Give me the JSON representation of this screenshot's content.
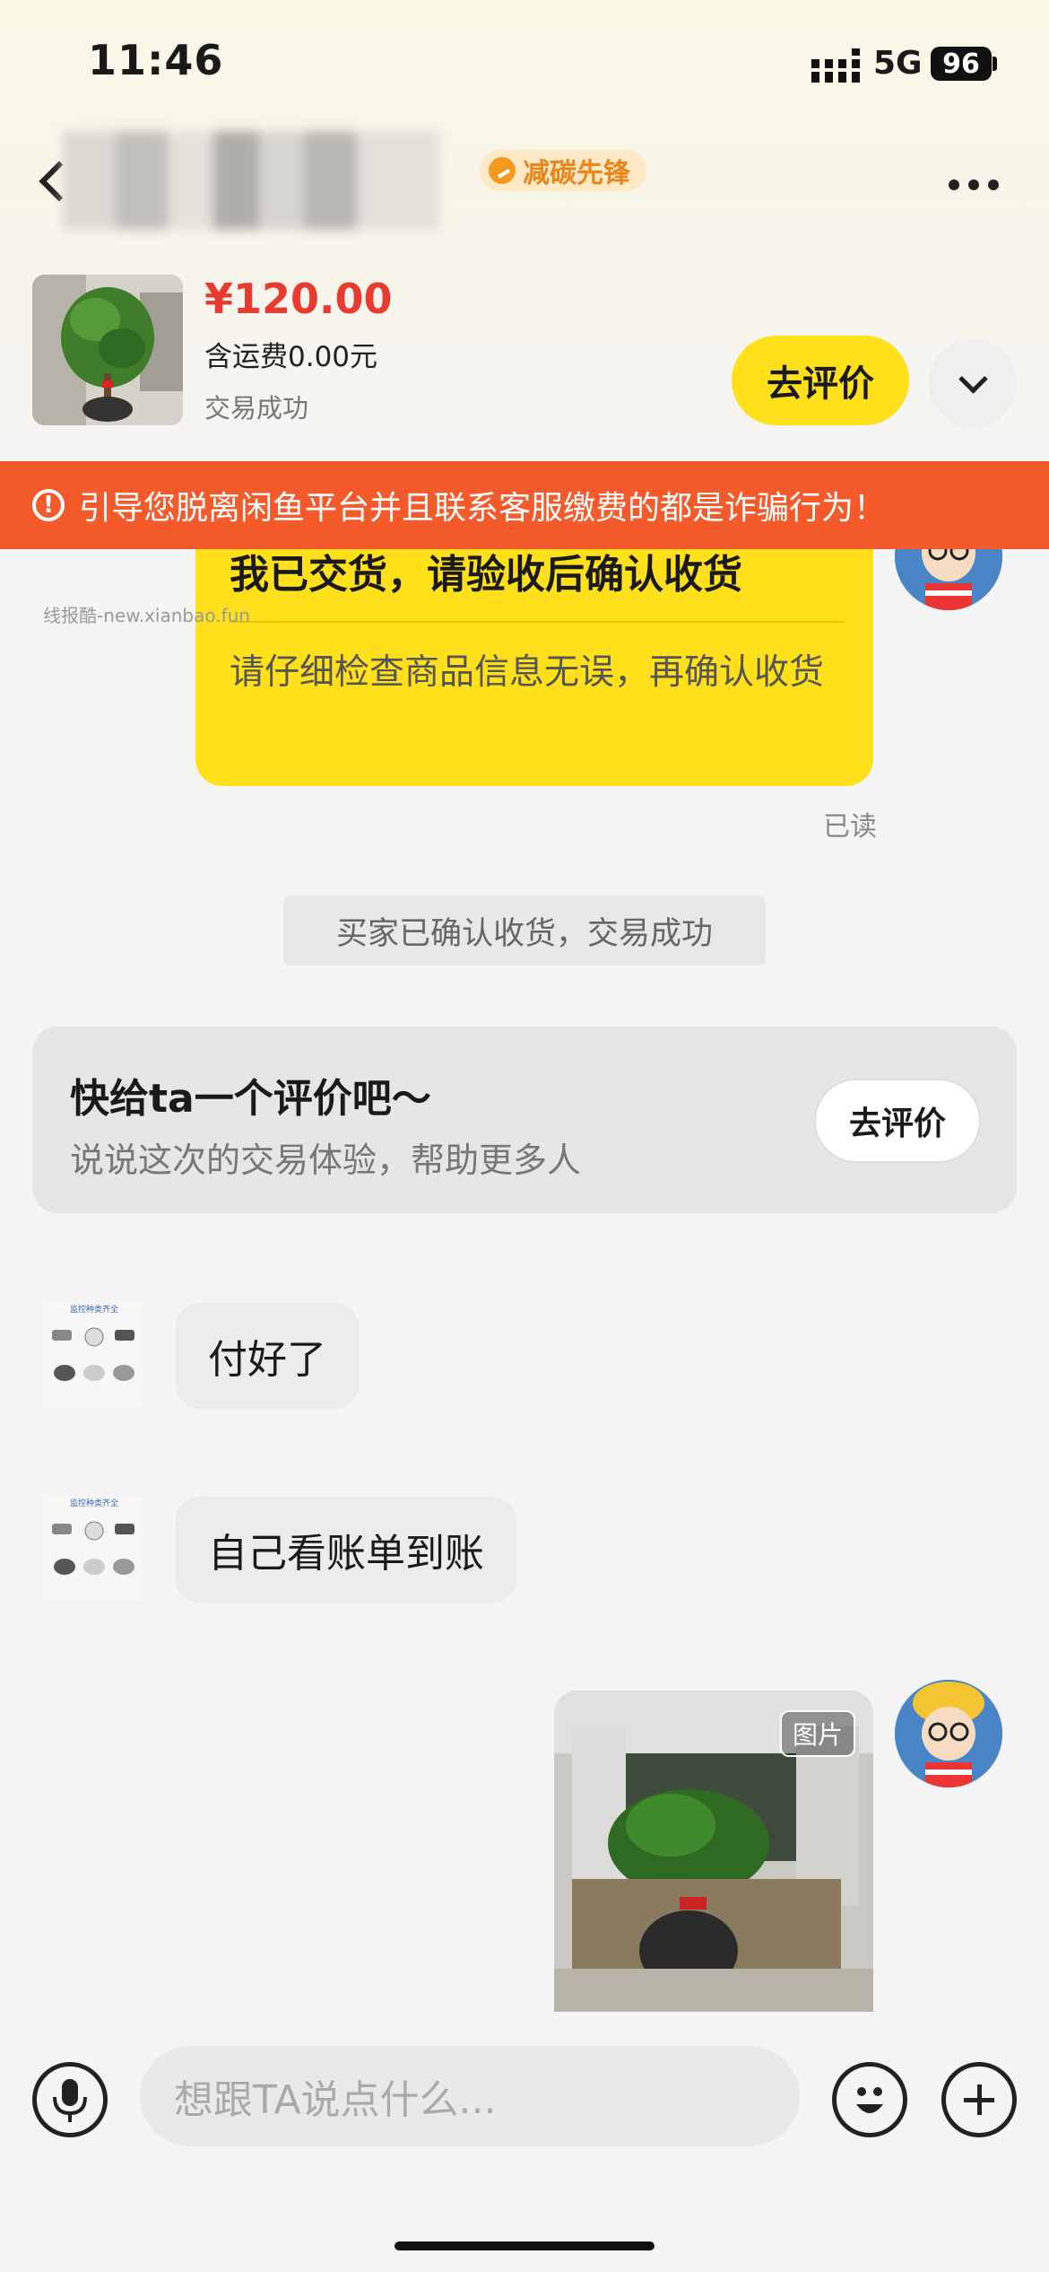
{
  "status_bar": {
    "time": "11:46",
    "network": "5G",
    "battery": "96"
  },
  "nav": {
    "badge": "减碳先锋"
  },
  "product": {
    "price": "¥120.00",
    "shipping": "含运费0.00元",
    "status": "交易成功",
    "review_button": "去评价"
  },
  "warning": {
    "text": "引导您脱离闲鱼平台并且联系客服缴费的都是诈骗行为！",
    "icon": "!"
  },
  "messages": {
    "delivery_card": {
      "title": "我已交货，请验收后确认收货",
      "description": "请仔细检查商品信息无误，再确认收货"
    },
    "read_status": "已读",
    "system_message": "买家已确认收货，交易成功",
    "review_card": {
      "title": "快给ta一个评价吧～",
      "subtitle": "说说这次的交易体验，帮助更多人",
      "button": "去评价"
    },
    "peer_1": "付好了",
    "peer_2": "自己看账单到账",
    "photo_tag": "图片",
    "peer_avatar_caption": "监控种类齐全"
  },
  "input_bar": {
    "placeholder": "想跟TA说点什么..."
  },
  "watermark": "线报酷-new.xianbao.fun",
  "colors": {
    "accent": "#ffe01b",
    "price": "#e83a2e",
    "warning": "#f45a2a"
  },
  "icons": [
    "back-icon",
    "more-icon",
    "chevron-down-icon",
    "warning-icon",
    "microphone-icon",
    "emoji-icon",
    "plus-icon"
  ]
}
